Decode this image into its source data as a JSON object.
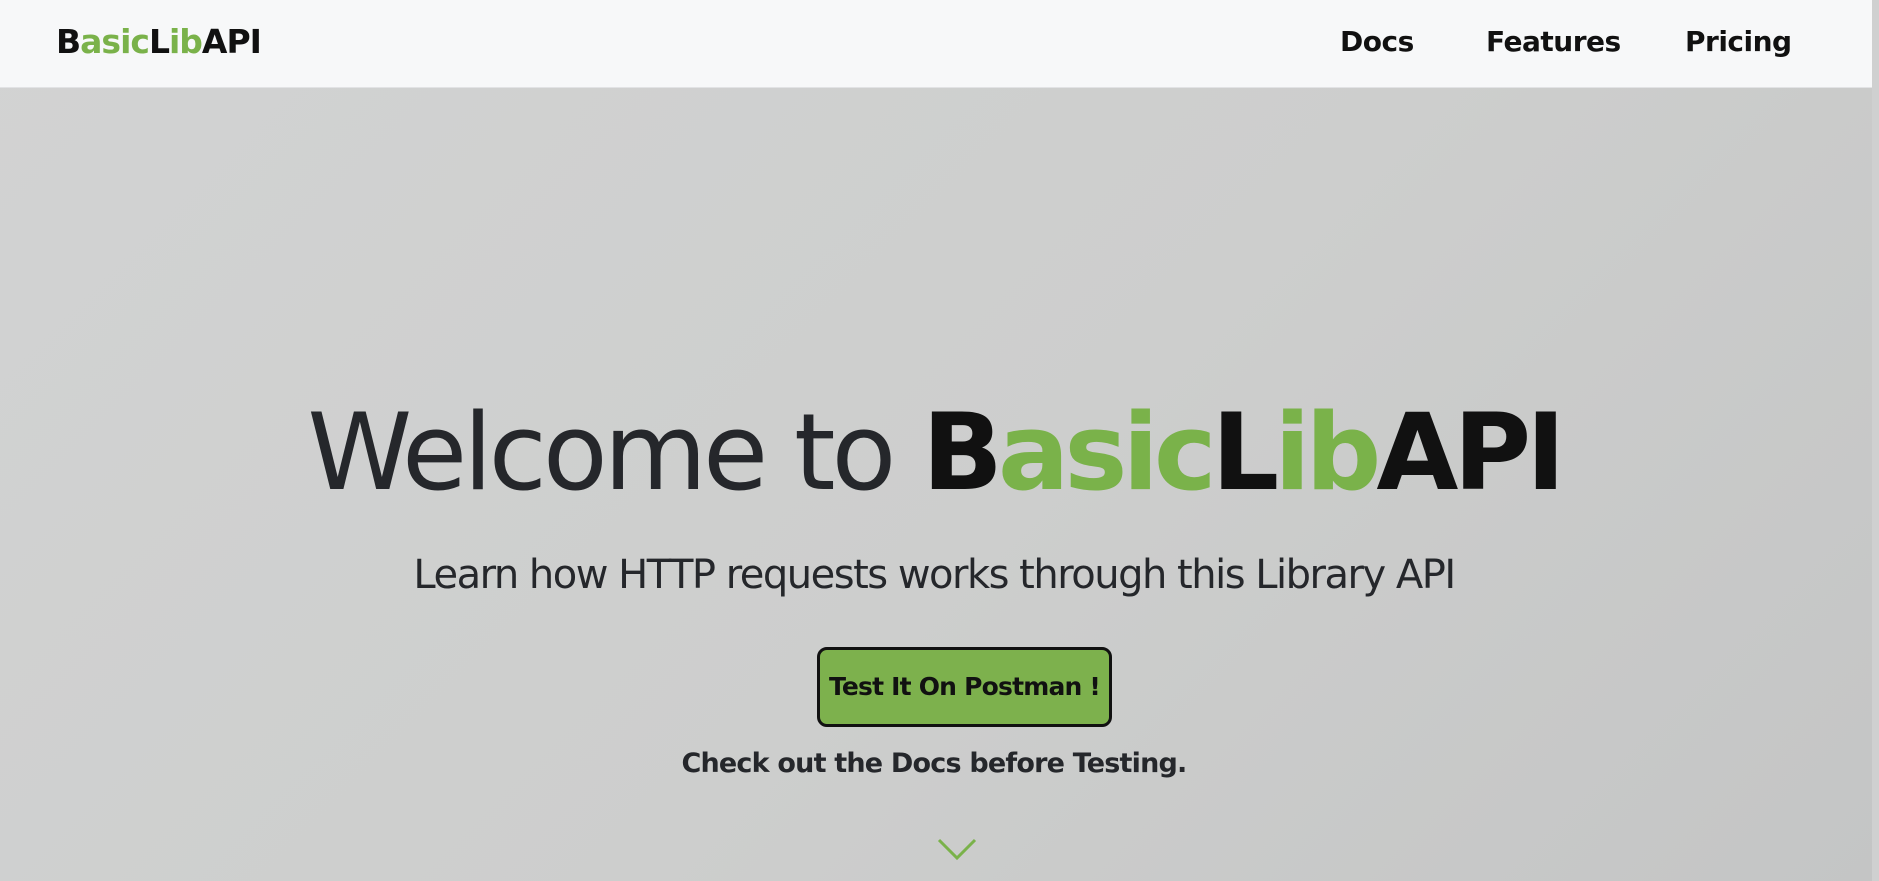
{
  "navbar": {
    "brand": {
      "parts": [
        "B",
        "asic",
        "L",
        "ib",
        "API"
      ]
    },
    "links": [
      {
        "label": "Docs"
      },
      {
        "label": "Features"
      },
      {
        "label": "Pricing"
      }
    ]
  },
  "hero": {
    "title_prefix": "Welcome to ",
    "title_brand_parts": [
      "B",
      "asic",
      "L",
      "ib",
      "API"
    ],
    "subtitle": "Learn how HTTP requests works through this Library API",
    "cta_label": "Test It On Postman !",
    "cta_note": "Check out the Docs before Testing.",
    "scroll_icon": "chevron-down-icon"
  },
  "colors": {
    "accent_green": "#7ab24a",
    "button_green": "#7db14d",
    "text_dark": "#25272b",
    "navbar_bg": "#f7f8f9",
    "hero_bg": "#cfd0d0"
  }
}
